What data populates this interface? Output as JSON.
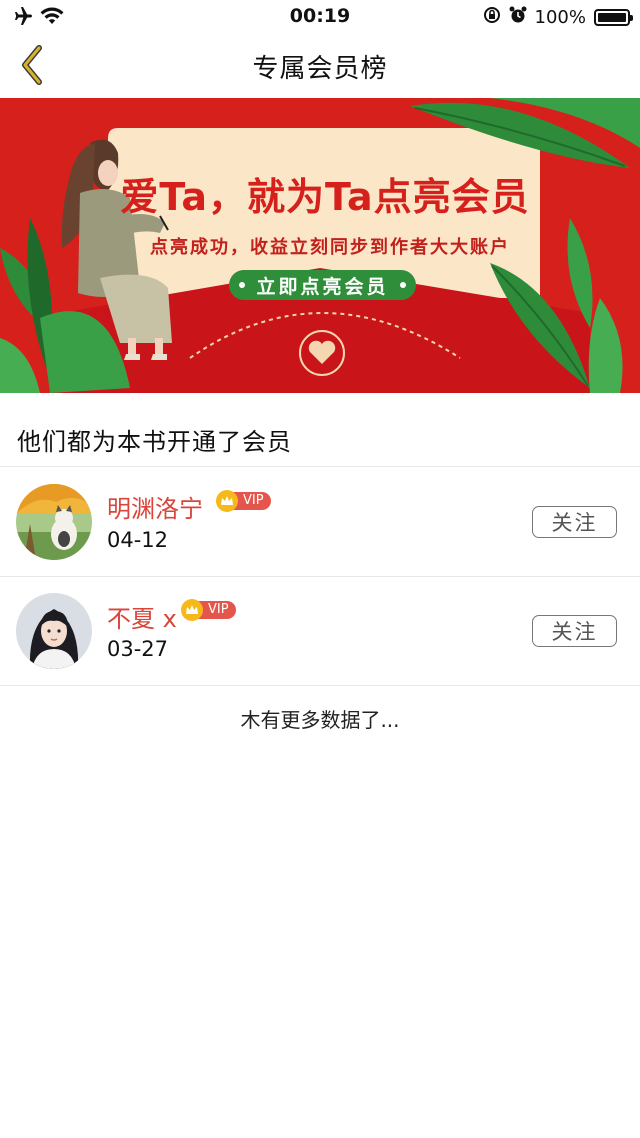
{
  "status_bar": {
    "time": "00:19",
    "battery_text": "100%",
    "battery_level": 1.0,
    "icons": [
      "airplane-icon",
      "wifi-icon",
      "orientation-lock-icon",
      "alarm-icon",
      "battery-icon"
    ]
  },
  "nav": {
    "title": "专属会员榜",
    "back_icon": "chevron-left-icon",
    "accent_color": "#c9a227"
  },
  "banner": {
    "headline": "爱Ta，就为Ta点亮会员",
    "subline": "点亮成功，收益立刻同步到作者大大账户",
    "cta_label": "立即点亮会员",
    "colors": {
      "background": "#d6201c",
      "card": "#fbe6c8",
      "cta": "#2f8e3a"
    }
  },
  "section": {
    "title": "他们都为本书开通了会员"
  },
  "members": [
    {
      "name": "明渊洛宁",
      "badge": "VIP",
      "date": "04-12",
      "follow_label": "关注",
      "avatar_icon": "avatar-illustration"
    },
    {
      "name": "不夏 x",
      "badge": "VIP",
      "date": "03-27",
      "follow_label": "关注",
      "avatar_icon": "avatar-photo"
    }
  ],
  "footer": {
    "end_text": "木有更多数据了..."
  },
  "colors": {
    "name": "#d9453a",
    "vip": "#e4564b",
    "crown": "#f6b91c"
  }
}
